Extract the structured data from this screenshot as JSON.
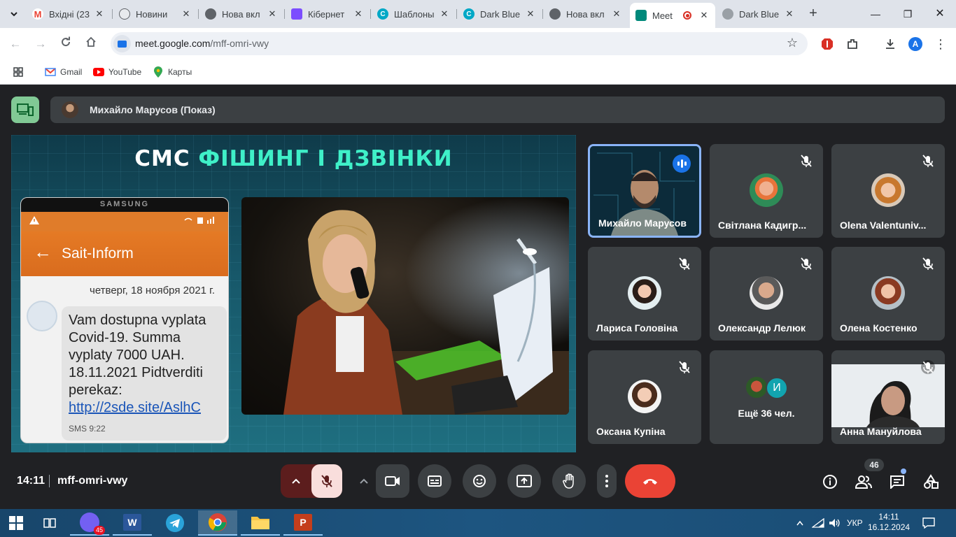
{
  "browser": {
    "tabs": [
      {
        "label": "Вхідні (23",
        "icon": "gmail-icon",
        "color": "#ea4335"
      },
      {
        "label": "Новини",
        "icon": "news-icon",
        "color": "#5f6368"
      },
      {
        "label": "Нова вкл",
        "icon": "chrome-icon",
        "color": "#5f6368"
      },
      {
        "label": "Кібернет",
        "icon": "slides-icon",
        "color": "#7c4dff"
      },
      {
        "label": "Шаблоны",
        "icon": "canva-icon",
        "color": "#00a8c6"
      },
      {
        "label": "Dark Blue",
        "icon": "canva-icon",
        "color": "#00a8c6"
      },
      {
        "label": "Нова вкл",
        "icon": "chrome-icon",
        "color": "#5f6368"
      },
      {
        "label": "Meet",
        "icon": "meet-icon",
        "color": "#00897b",
        "active": true
      },
      {
        "label": "Dark Blue",
        "icon": "globe-icon",
        "color": "#5f6368"
      }
    ],
    "url_host": "meet.google.com",
    "url_path": "/mff-omri-vwy",
    "profile_initial": "A",
    "bookmarks": [
      {
        "label": "Gmail",
        "icon": "gmail-icon"
      },
      {
        "label": "YouTube",
        "icon": "youtube-icon"
      },
      {
        "label": "Карты",
        "icon": "maps-icon"
      }
    ]
  },
  "meet": {
    "presenter_label": "Михайло Марусов (Показ)",
    "slide": {
      "title_part1": "СМС",
      "title_part2": "ФІШИНГ І ДЗВІНКИ",
      "phone_brand": "SAMSUNG",
      "sender": "Sait-Inform",
      "date": "четверг, 18 ноября 2021 г.",
      "message": "Vam dostupna vyplata Covid-19. Summa vyplaty 7000 UAH. 18.11.2021 Pidtverditi perekaz:",
      "link": "http://2sde.site/AslhC",
      "sms_meta": "SMS 9:22"
    },
    "participants": [
      {
        "name": "Михайло Марусов",
        "speaking": true
      },
      {
        "name": "Світлана Кадигр...",
        "muted": true
      },
      {
        "name": "Olena Valentuniv...",
        "muted": true
      },
      {
        "name": "Лариса Головіна",
        "muted": true
      },
      {
        "name": "Олександр Лелюк",
        "muted": true
      },
      {
        "name": "Олена Костенко",
        "muted": true
      },
      {
        "name": "Оксана Купіна",
        "muted": true
      },
      {
        "name": "Анна Мануйлова",
        "muted": true
      }
    ],
    "more": {
      "initial": "И",
      "label": "Ещё 36 чел."
    },
    "time": "14:11",
    "meeting_code": "mff-omri-vwy",
    "people_count": "46"
  },
  "taskbar": {
    "viber_badge": "45",
    "language": "УКР",
    "time": "14:11",
    "date": "16.12.2024"
  },
  "colors": {
    "meet_bg": "#202124",
    "tile_bg": "#3c4043",
    "end_call": "#ea4335",
    "speaking_border": "#8ab4f8",
    "slide_accent": "#3ff0c8"
  }
}
